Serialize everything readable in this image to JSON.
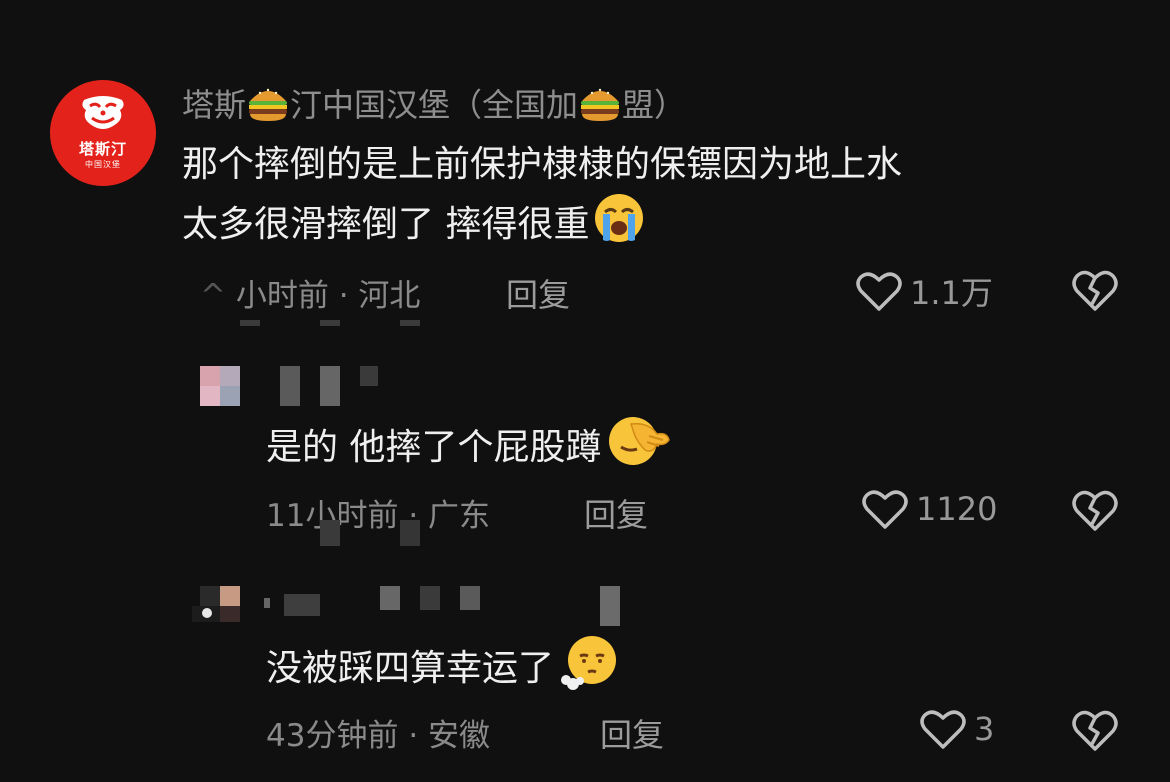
{
  "comments": [
    {
      "username_parts": [
        "塔斯",
        "汀中国汉堡（全国加",
        "盟）"
      ],
      "username_emoji": "burger-emoji",
      "avatar": {
        "brand": "塔斯汀",
        "sub": "中国汉堡",
        "color": "#e3231b"
      },
      "text_line1": "那个摔倒的是上前保护棣棣的保镖因为地上水",
      "text_line2": "太多很滑摔倒了 摔得很重",
      "text_emoji": "loudly-crying-face-emoji",
      "time": "小时前",
      "location": "河北",
      "separator": "·",
      "reply_label": "回复",
      "likes": "1.1万"
    },
    {
      "text": "是的 他摔了个屁股蹲",
      "text_emoji": "face-palm-emoji",
      "time": "11小时前",
      "location": "广东",
      "separator": "·",
      "reply_label": "回复",
      "likes": "1120"
    },
    {
      "text": "没被踩四算幸运了",
      "text_emoji": "face-exhaling-emoji",
      "time": "43分钟前",
      "location": "安徽",
      "separator": "·",
      "reply_label": "回复",
      "likes": "3"
    }
  ]
}
